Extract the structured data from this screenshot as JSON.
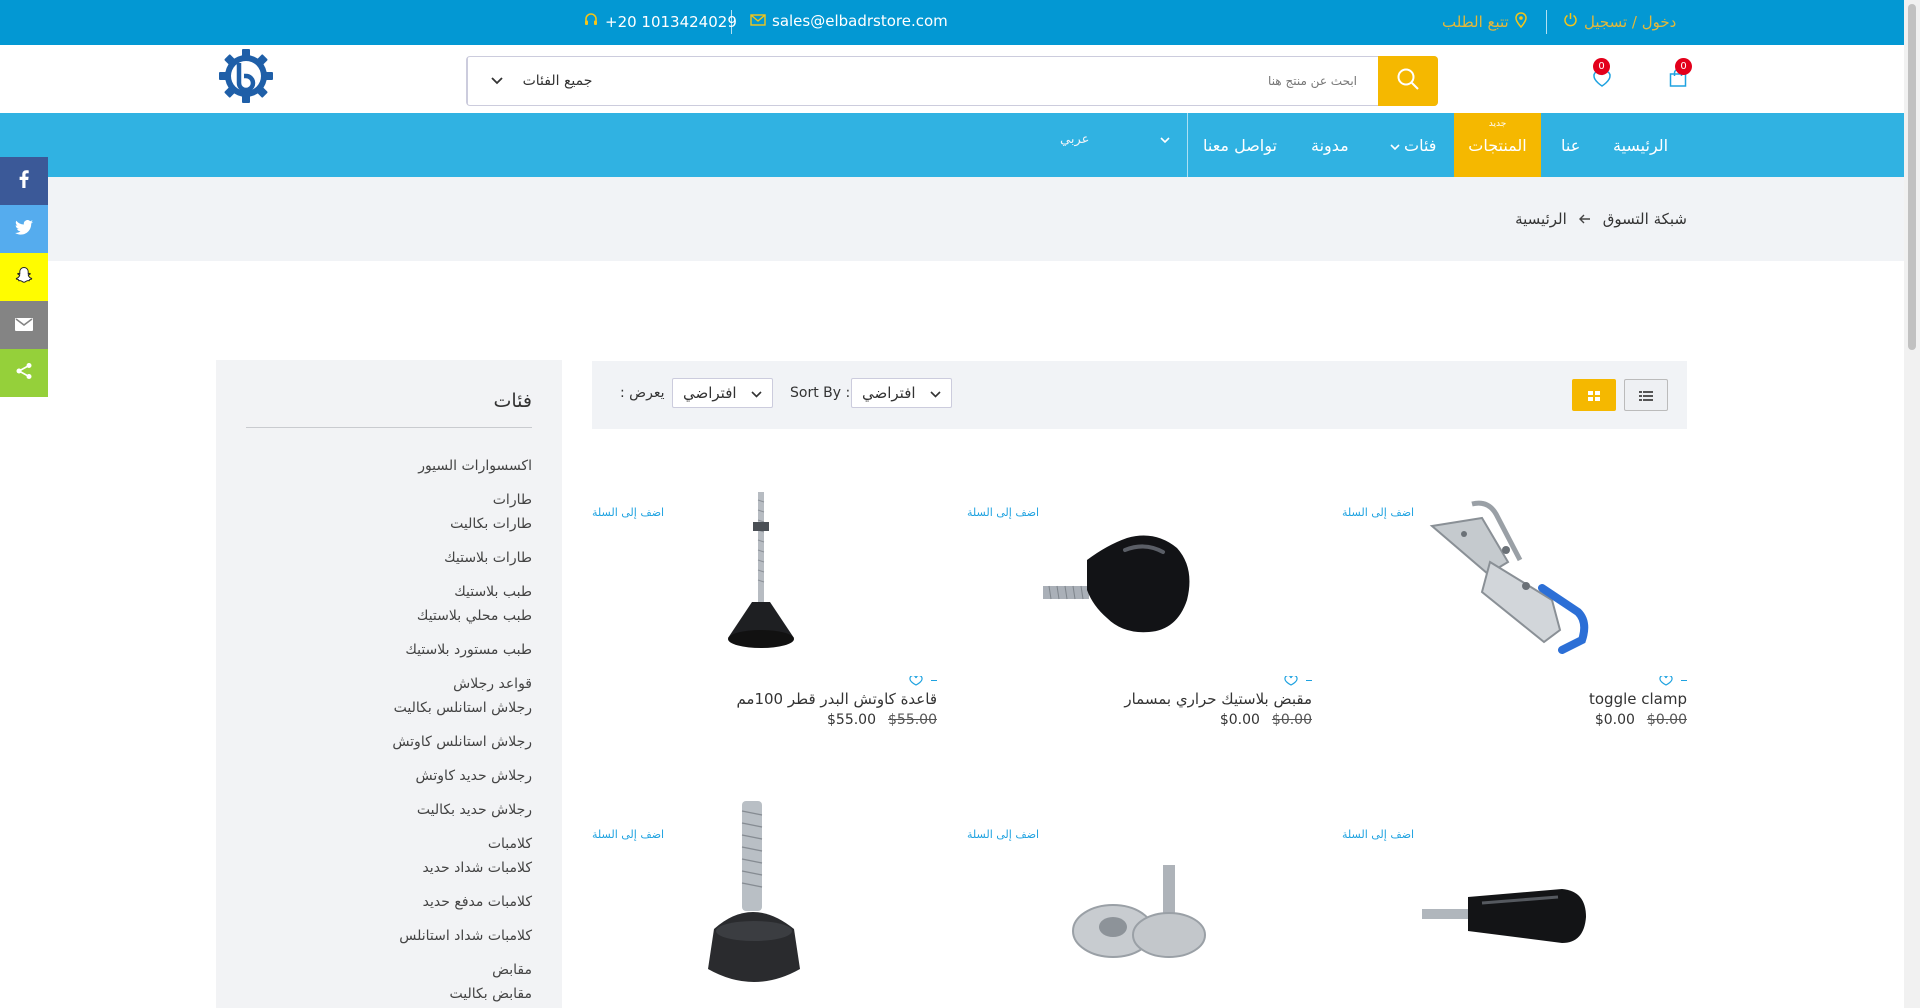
{
  "topbar": {
    "phone": "+20 1013424029",
    "email": "sales@elbadrstore.com",
    "track_order": "تتبع الطلب",
    "login": "دخول / تسجيل"
  },
  "header": {
    "search_placeholder": "ابحث عن منتج هنا",
    "category_select": "جميع الفئات",
    "cart_count": "0",
    "wishlist_count": "0"
  },
  "nav": {
    "home": "الرئيسية",
    "about": "عنا",
    "products": "المنتجات",
    "products_tag": "جديد",
    "categories": "فئات",
    "blog": "مدونة",
    "contact": "تواصل معنا",
    "language": "عربي"
  },
  "breadcrumb": {
    "home": "الرئيسية",
    "current": "شبكة التسوق"
  },
  "sidebar": {
    "title": "فئات",
    "items": [
      "اكسسوارات السيور",
      "طارات",
      "طارات بكاليت",
      "طارات بلاستيك",
      "طبب بلاستيك",
      "طبب محلي بلاستيك",
      "طبب مستورد بلاستيك",
      "قواعد رجلاش",
      "رجلاش استانلس بكاليت",
      "رجلاش استانلس كاوتش",
      "رجلاش حديد كاوتش",
      "رجلاش حديد بكاليت",
      "كلامبات",
      "كلامبات شداد حديد",
      "كلامبات مدفع حديد",
      "كلامبات شداد استانلس",
      "مقابض",
      "مقابض بكاليت"
    ]
  },
  "toolbar": {
    "sort_label": "Sort By :",
    "sort_value": "افتراضي",
    "show_label": ": يعرض",
    "show_value": "افتراضي"
  },
  "products": {
    "add_to_cart": "اضف إلى السلة",
    "row1": [
      {
        "name": "toggle clamp",
        "price": "$0.00",
        "old_price": "$0.00"
      },
      {
        "name": "مقبض بلاستيك حراري بمسمار",
        "price": "$0.00",
        "old_price": "$0.00"
      },
      {
        "name": "قاعدة كاوتش البدر قطر 100مم",
        "price": "$55.00",
        "old_price": "$55.00"
      }
    ]
  },
  "share": [
    "facebook-icon",
    "twitter-icon",
    "snapchat-icon",
    "email-icon",
    "share-icon"
  ],
  "colors": {
    "topbar": "#0398d3",
    "nav": "#30b2e2",
    "accent": "#f5b800",
    "link": "#1ea2e0",
    "badge": "#e3001b"
  }
}
